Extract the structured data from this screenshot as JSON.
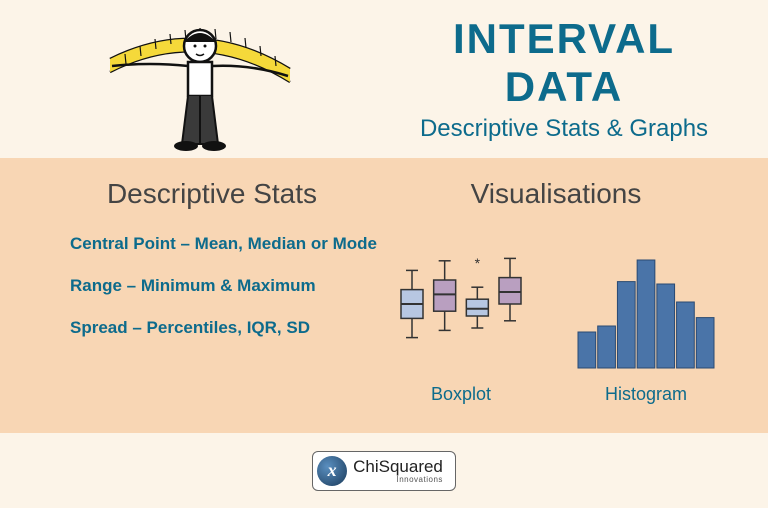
{
  "header": {
    "title": "INTERVAL DATA",
    "subtitle": "Descriptive Stats & Graphs"
  },
  "sections": {
    "stats": {
      "title": "Descriptive Stats",
      "items": [
        "Central Point – Mean, Median or Mode",
        "Range – Minimum & Maximum",
        "Spread – Percentiles, IQR, SD"
      ]
    },
    "viz": {
      "title": "Visualisations",
      "items": [
        "Boxplot",
        "Histogram"
      ]
    }
  },
  "footer": {
    "brand_main": "ChiSquared",
    "brand_sub": "Innovations",
    "brand_glyph": "x"
  },
  "chart_data": [
    {
      "type": "boxplot",
      "note": "illustrative miniature boxplot icon, 4 boxes with whiskers, one outlier asterisk",
      "series": [
        {
          "median": 50,
          "q1": 38,
          "q3": 62,
          "low": 22,
          "high": 78,
          "color": "#b7c7e2"
        },
        {
          "median": 58,
          "q1": 44,
          "q3": 70,
          "low": 28,
          "high": 86,
          "color": "#b99fc0"
        },
        {
          "median": 46,
          "q1": 40,
          "q3": 54,
          "low": 30,
          "high": 64,
          "color": "#b7c7e2",
          "outlier": 80
        },
        {
          "median": 60,
          "q1": 50,
          "q3": 72,
          "low": 36,
          "high": 88,
          "color": "#b99fc0"
        }
      ]
    },
    {
      "type": "bar",
      "note": "illustrative miniature histogram icon",
      "values": [
        30,
        35,
        72,
        90,
        70,
        55,
        42
      ],
      "color": "#4a74a8"
    }
  ]
}
